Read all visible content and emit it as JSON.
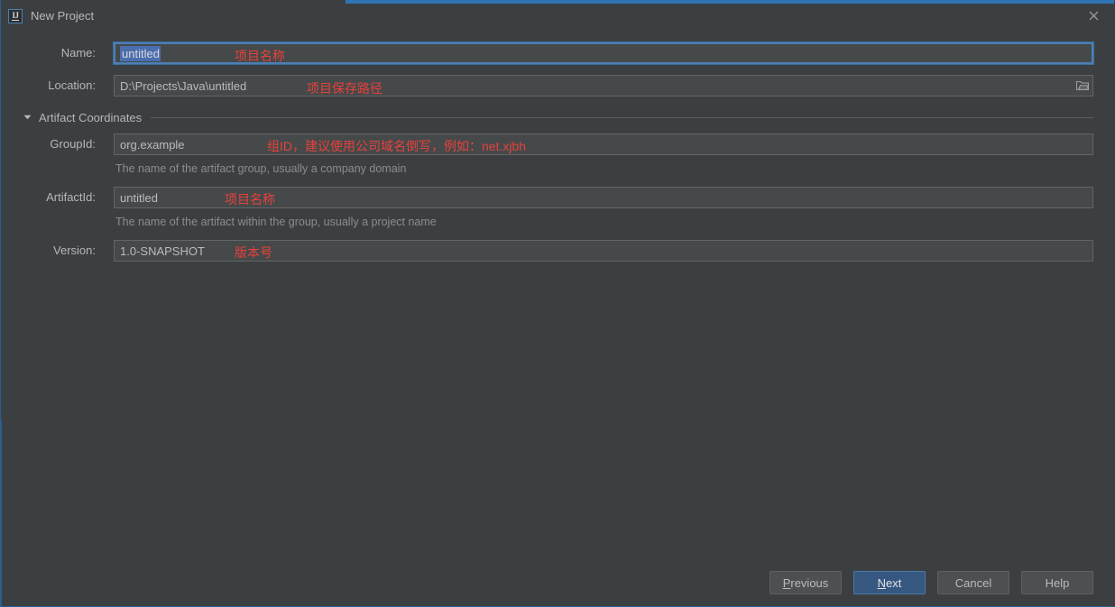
{
  "window": {
    "title": "New Project",
    "app_icon": "intellij-idea-icon",
    "close_icon": "close-icon",
    "accent_color": "#2f74b5",
    "background_color": "#3c3f41"
  },
  "form": {
    "fields": [
      {
        "id": "name",
        "label": "Name:",
        "value": "untitled",
        "selected": true,
        "focused": true,
        "annotation": "项目名称",
        "helper": null,
        "browse": false
      },
      {
        "id": "location",
        "label": "Location:",
        "value": "D:\\Projects\\Java\\untitled",
        "selected": false,
        "focused": false,
        "annotation": "项目保存路径",
        "helper": null,
        "browse": true,
        "browse_icon": "folder-icon"
      }
    ],
    "section": {
      "title": "Artifact Coordinates",
      "expanded": true,
      "toggle_icon": "chevron-down-icon",
      "fields": [
        {
          "id": "groupid",
          "label": "GroupId:",
          "value": "org.example",
          "annotation": "组ID，建议使用公司域名倒写，例如：net.xjbh",
          "helper": "The name of the artifact group, usually a company domain"
        },
        {
          "id": "artifactid",
          "label": "ArtifactId:",
          "value": "untitled",
          "annotation": "项目名称",
          "helper": "The name of the artifact within the group, usually a project name"
        },
        {
          "id": "version",
          "label": "Version:",
          "value": "1.0-SNAPSHOT",
          "annotation": "版本号",
          "helper": null
        }
      ]
    }
  },
  "footer": {
    "buttons": [
      {
        "id": "previous",
        "pre": "",
        "mnemonic": "P",
        "post": "revious",
        "primary": false
      },
      {
        "id": "next",
        "pre": "",
        "mnemonic": "N",
        "post": "ext",
        "primary": true
      },
      {
        "id": "cancel",
        "pre": "Cancel",
        "mnemonic": "",
        "post": "",
        "primary": false
      },
      {
        "id": "help",
        "pre": "Help",
        "mnemonic": "",
        "post": "",
        "primary": false
      }
    ]
  },
  "annotation_color": "#e8413c"
}
